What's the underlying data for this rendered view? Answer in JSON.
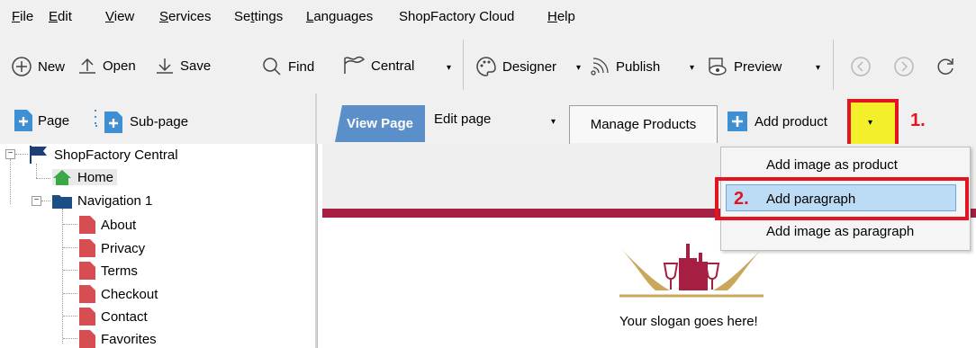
{
  "menu": [
    {
      "label": "File",
      "underline": "F",
      "rest": "ile"
    },
    {
      "label": "Edit",
      "underline": "E",
      "rest": "dit"
    },
    {
      "label": "View",
      "underline": "V",
      "rest": "iew"
    },
    {
      "label": "Services",
      "underline": "S",
      "rest": "ervices"
    },
    {
      "label": "Settings",
      "pre": "Se",
      "underline": "t",
      "rest": "tings"
    },
    {
      "label": "Languages",
      "underline": "L",
      "rest": "anguages"
    },
    {
      "label": "ShopFactory Cloud",
      "pre": "ShopFactory Cloud",
      "underline": "",
      "rest": ""
    },
    {
      "label": "Help",
      "underline": "H",
      "rest": "elp"
    }
  ],
  "toolbar": {
    "new": "New",
    "open": "Open",
    "save": "Save",
    "find": "Find",
    "central": "Central",
    "designer": "Designer",
    "publish": "Publish",
    "preview": "Preview"
  },
  "left": {
    "page": "Page",
    "subpage": "Sub-page"
  },
  "tree": {
    "root": "ShopFactory Central",
    "home": "Home",
    "nav1": "Navigation 1",
    "children": [
      "About",
      "Privacy",
      "Terms",
      "Checkout",
      "Contact",
      "Favorites"
    ]
  },
  "tabs": {
    "view": "View Page",
    "edit": "Edit page",
    "manage": "Manage Products",
    "add_product": "Add product"
  },
  "dropdown": {
    "items": [
      "Add image as product",
      "Add paragraph",
      "Add image as paragraph"
    ]
  },
  "annotations": {
    "step1": "1.",
    "step2": "2."
  },
  "content": {
    "slogan": "Your slogan goes here!"
  },
  "colors": {
    "accent_tab": "#5b8fc9",
    "highlight": "#f3ef2b",
    "annotation_red": "#e3141f",
    "stripe": "#a71e43",
    "logo_gold": "#c9a85a"
  }
}
